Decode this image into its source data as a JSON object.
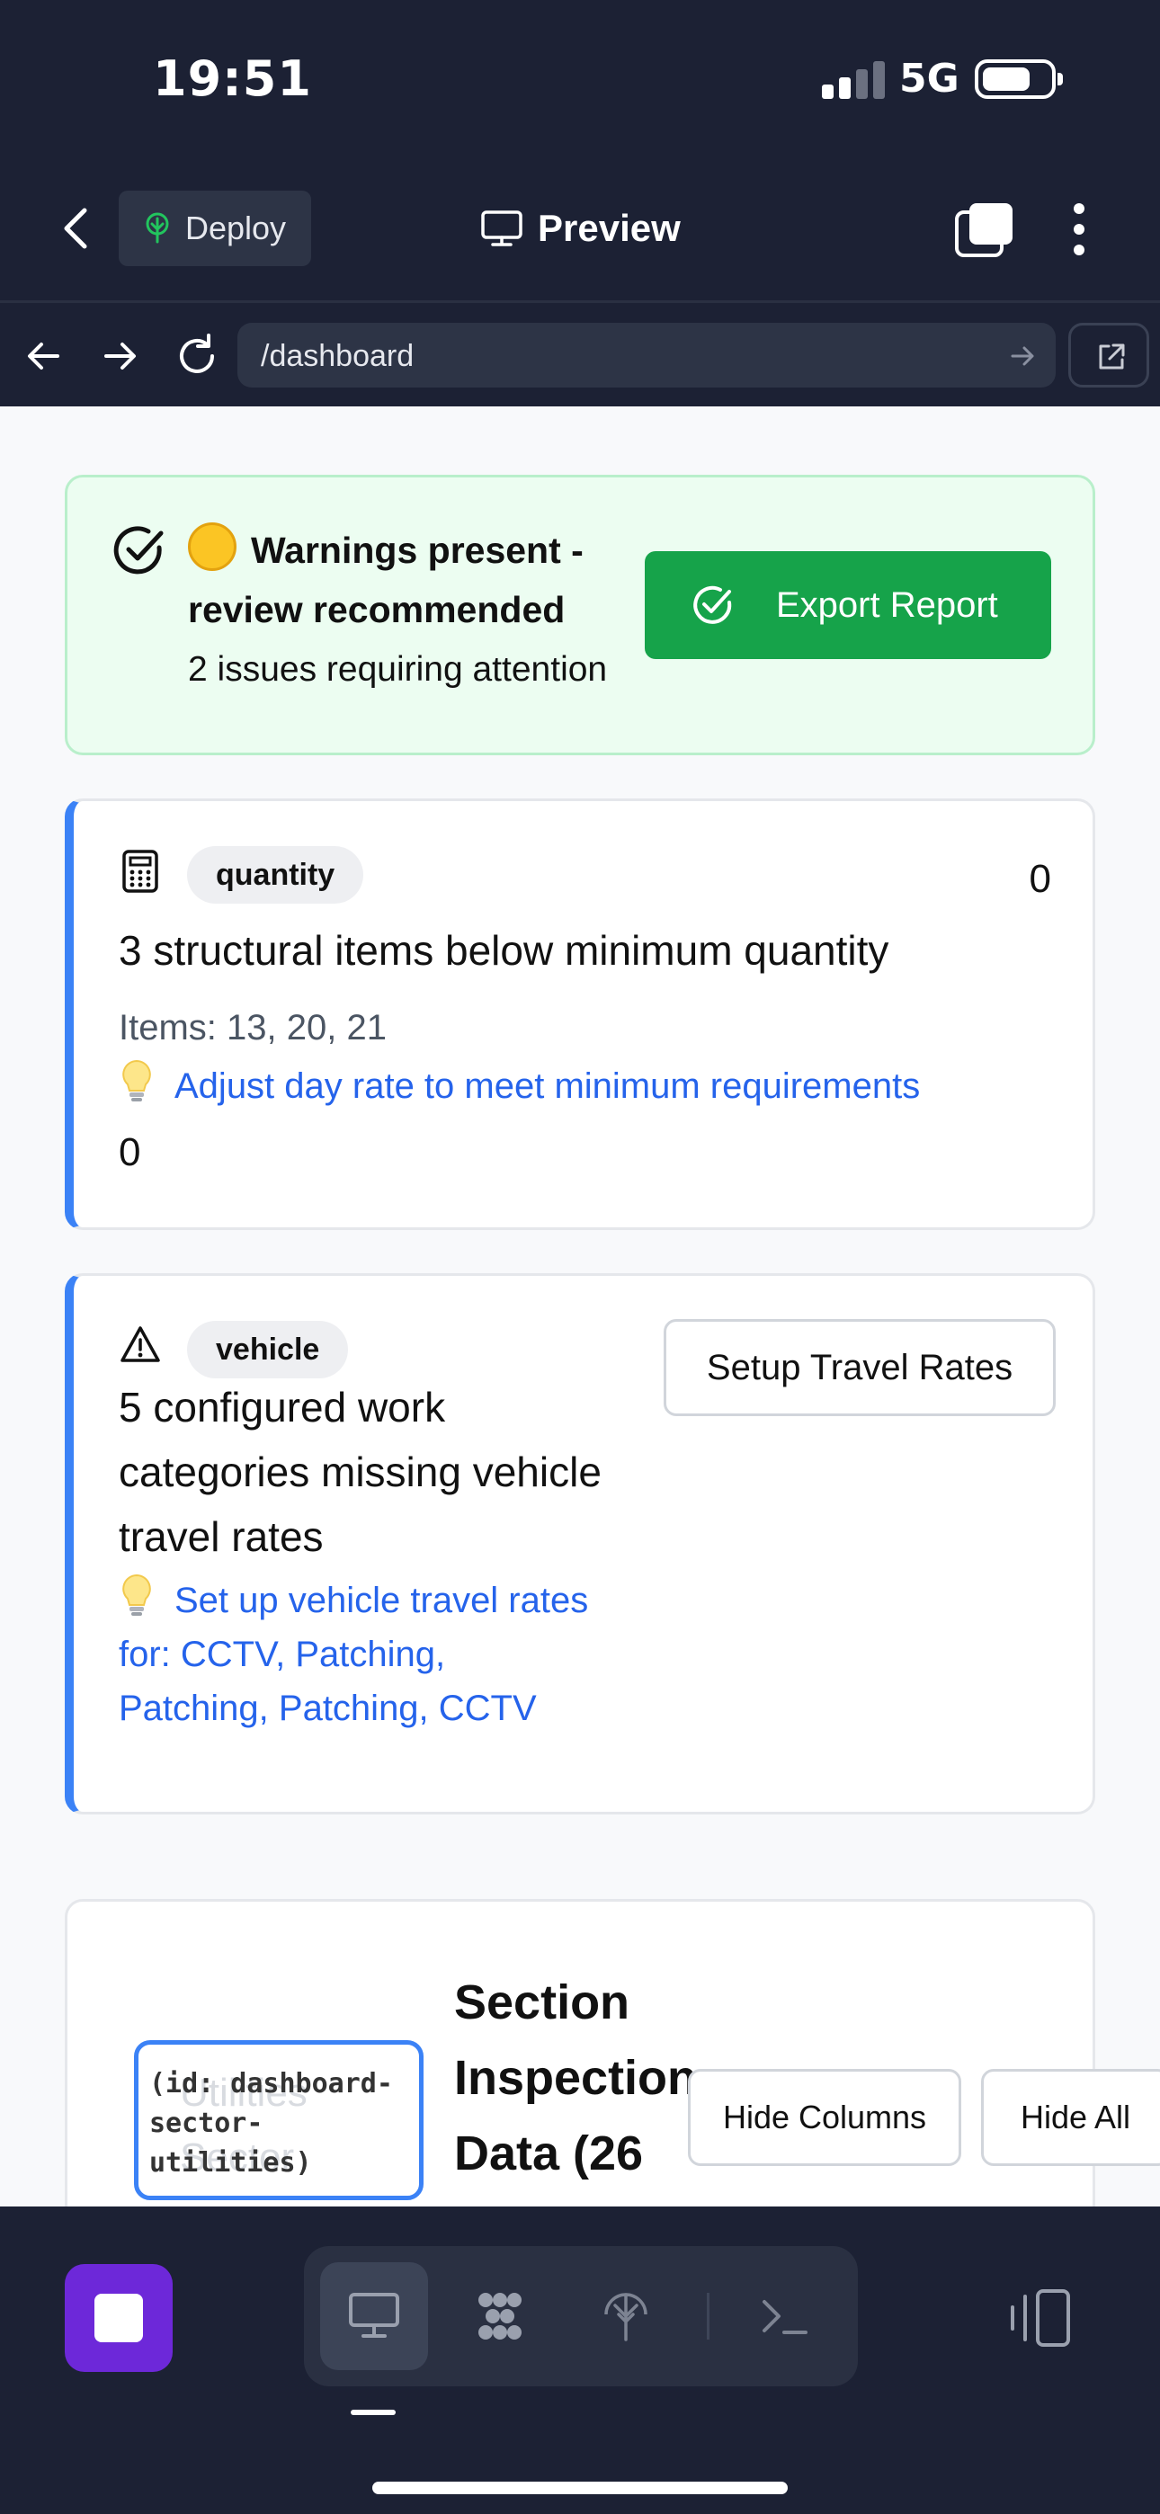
{
  "status_bar": {
    "time": "19:51",
    "network": "5G"
  },
  "toolbar": {
    "deploy_label": "Deploy",
    "preview_label": "Preview"
  },
  "url_bar": {
    "path": "/dashboard"
  },
  "banner": {
    "title": "Warnings present - review recommended",
    "subtitle": "2 issues requiring attention",
    "export_label": "Export Report"
  },
  "issues": [
    {
      "category": "quantity",
      "count": "0",
      "message": "3 structural items below minimum quantity",
      "items": "Items: 13, 20, 21",
      "suggestion": "Adjust day rate to meet minimum requirements",
      "footer_value": "0"
    },
    {
      "category": "vehicle",
      "message": "5 configured work categories missing vehicle travel rates",
      "suggestion": "Set up vehicle travel rates for: CCTV, Patching, Patching, Patching, CCTV",
      "action_label": "Setup Travel Rates"
    }
  ],
  "section": {
    "title": "Section Inspection Data (26",
    "id_tag": "(id: dashboard-sector-utilities)",
    "ghost_text": "Utilities Sector",
    "hide_columns_label": "Hide Columns",
    "hide_all_label": "Hide All"
  },
  "colors": {
    "chrome_bg": "#1c2134",
    "success_green": "#16a34a",
    "accent_blue": "#3b82f6",
    "link_blue": "#2563eb",
    "stop_purple": "#6d28d9"
  },
  "icons": {
    "banner": "check-circle-icon",
    "quantity": "calculator-icon",
    "vehicle": "warning-triangle-icon",
    "suggestion": "lightbulb-icon"
  }
}
